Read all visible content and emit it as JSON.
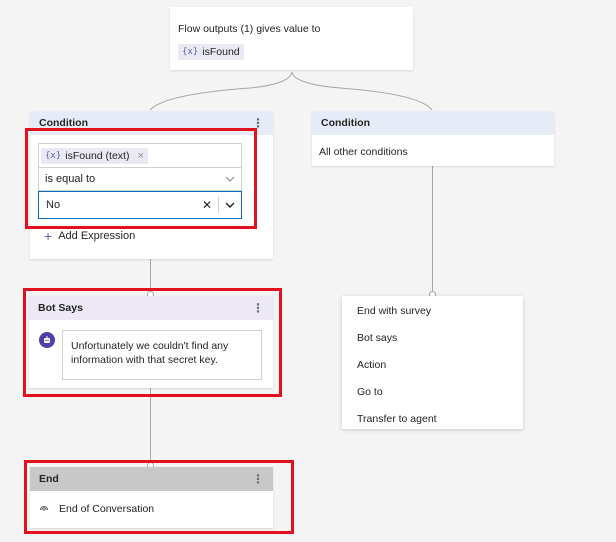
{
  "flow_outputs": {
    "text": "Flow outputs (1) gives value to",
    "variable": "isFound",
    "var_glyph": "{x}"
  },
  "condition_left": {
    "title": "Condition",
    "variable_chip": "isFound (text)",
    "var_glyph": "{x}",
    "operator": "is equal to",
    "value": "No",
    "add_expression": "Add Expression"
  },
  "condition_right": {
    "title": "Condition",
    "body": "All other conditions"
  },
  "bot_says": {
    "title": "Bot Says",
    "message": "Unfortunately we couldn't find any information with that secret key."
  },
  "end_node": {
    "title": "End",
    "body": "End of Conversation"
  },
  "add_menu": {
    "items": [
      "End with survey",
      "Bot says",
      "Action",
      "Go to",
      "Transfer to agent"
    ]
  },
  "colors": {
    "accent": "#5b5fc7",
    "highlight_border": "#e3101f",
    "condition_header": "#e5ecf8",
    "bot_header": "#ece8f6",
    "end_header": "#c8c8c8",
    "canvas": "#f4f4f4"
  }
}
